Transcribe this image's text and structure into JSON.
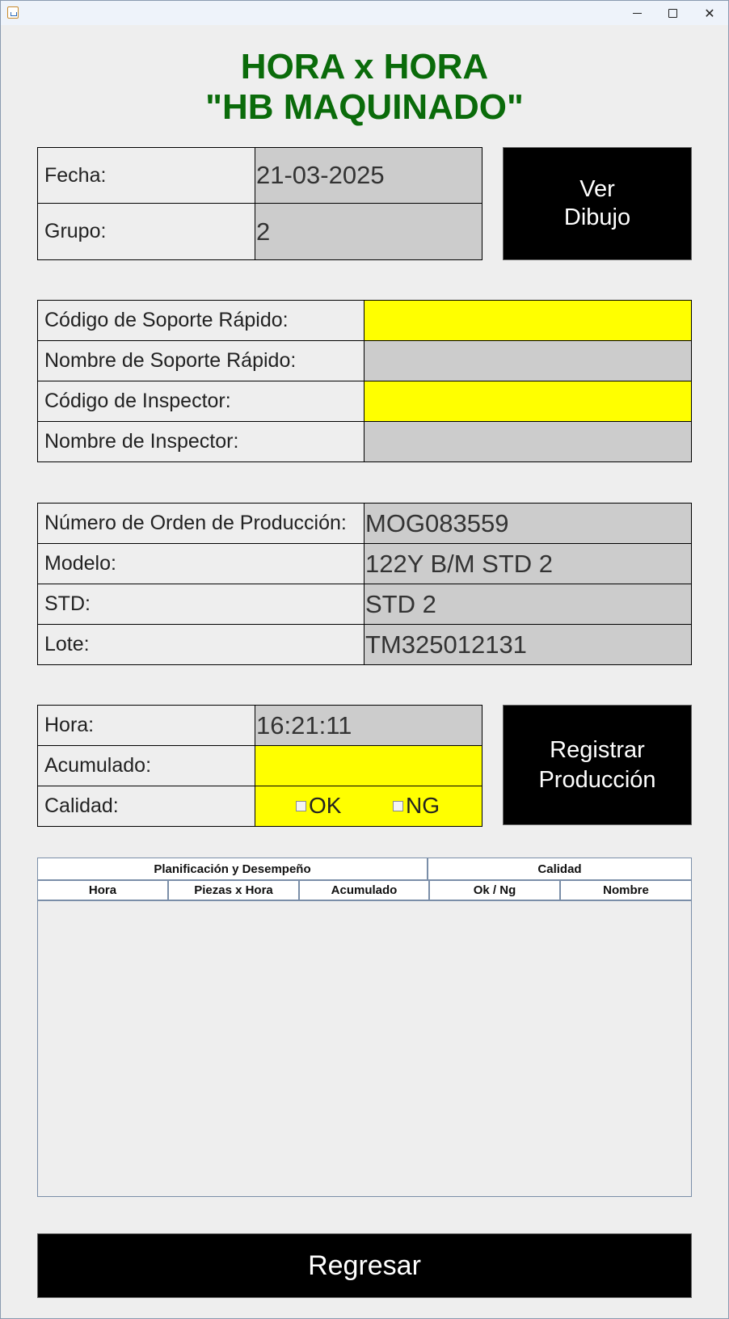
{
  "window": {
    "minimize": "─",
    "maximize": "☐",
    "close": "✕"
  },
  "title": {
    "line1": "HORA x HORA",
    "line2": "\"HB MAQUINADO\""
  },
  "header_fields": {
    "fecha_label": "Fecha:",
    "fecha_value": "21-03-2025",
    "grupo_label": "Grupo:",
    "grupo_value": "2"
  },
  "ver_dibujo_button": {
    "line1": "Ver",
    "line2": "Dibujo"
  },
  "soporte": {
    "codigo_soporte_label": "Código de Soporte Rápido:",
    "codigo_soporte_value": "",
    "nombre_soporte_label": "Nombre de Soporte Rápido:",
    "nombre_soporte_value": "",
    "codigo_inspector_label": "Código de Inspector:",
    "codigo_inspector_value": "",
    "nombre_inspector_label": "Nombre de Inspector:",
    "nombre_inspector_value": ""
  },
  "orden": {
    "numero_label": "Número de Orden de Producción:",
    "numero_value": "MOG083559",
    "modelo_label": "Modelo:",
    "modelo_value": "122Y B/M STD 2",
    "std_label": "STD:",
    "std_value": "STD 2",
    "lote_label": "Lote:",
    "lote_value": "TM325012131"
  },
  "produccion": {
    "hora_label": "Hora:",
    "hora_value": "16:21:11",
    "acumulado_label": "Acumulado:",
    "acumulado_value": "",
    "calidad_label": "Calidad:",
    "ok_label": "OK",
    "ng_label": "NG",
    "ok_checked": false,
    "ng_checked": false
  },
  "registrar_button": {
    "line1": "Registrar",
    "line2": "Producción"
  },
  "table": {
    "group_headers": [
      "Planificación y Desempeño",
      "Calidad"
    ],
    "columns": [
      "Hora",
      "Piezas x Hora",
      "Acumulado",
      "Ok / Ng",
      "Nombre"
    ],
    "rows": []
  },
  "regresar_button": "Regresar",
  "colors": {
    "title_green": "#0a6b0a",
    "input_yellow": "#ffff00",
    "readonly_gray": "#cccccc",
    "button_black": "#000000"
  }
}
